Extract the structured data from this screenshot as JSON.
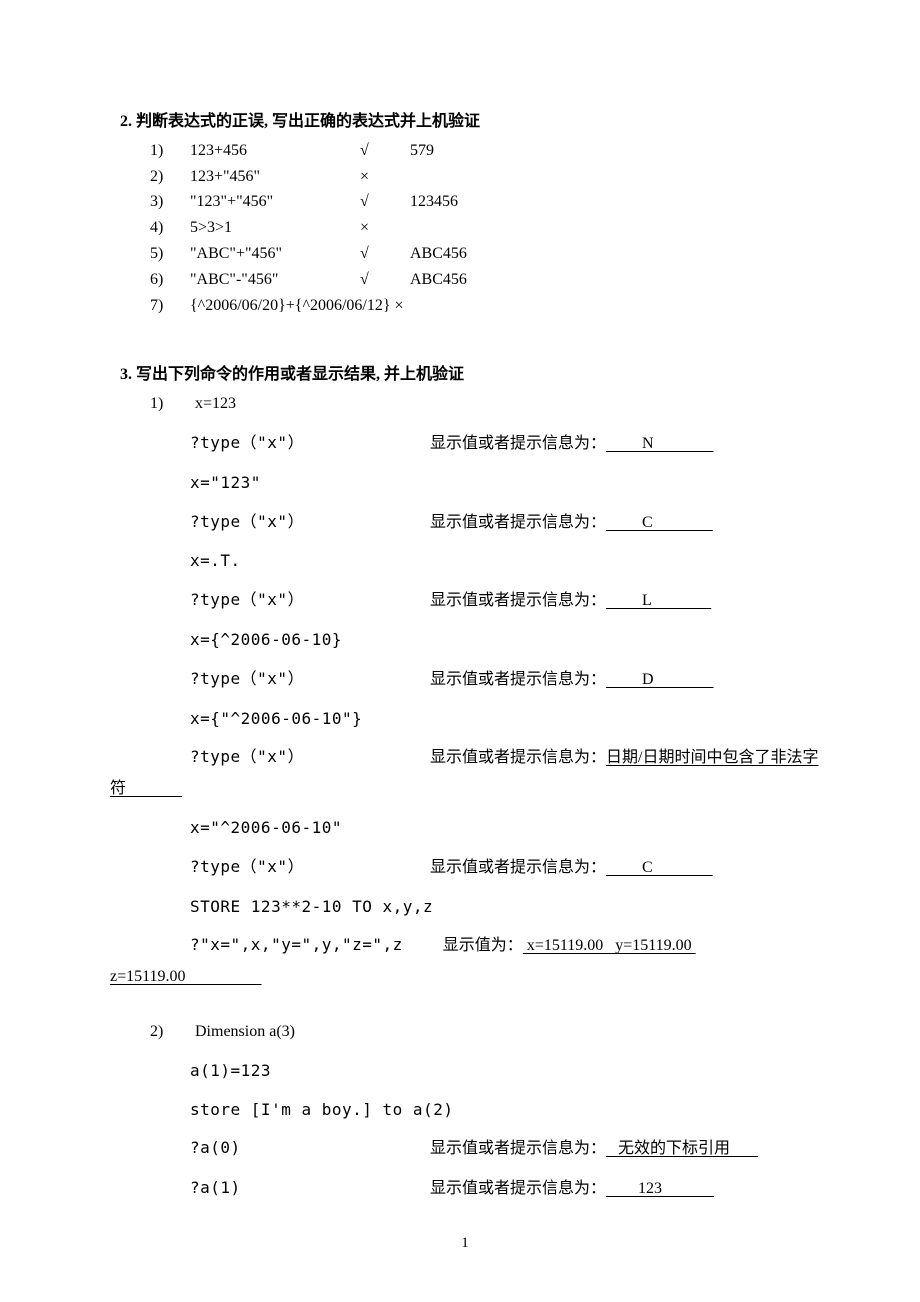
{
  "section2": {
    "heading": "2.  判断表达式的正误, 写出正确的表达式并上机验证",
    "items": [
      {
        "num": "1)",
        "expr": "123+456",
        "mark": "√",
        "result": "579"
      },
      {
        "num": "2)",
        "expr": "123+\"456\"",
        "mark": "×",
        "result": ""
      },
      {
        "num": "3)",
        "expr": "\"123\"+\"456\"",
        "mark": "√",
        "result": "123456"
      },
      {
        "num": "4)",
        "expr": "5>3>1",
        "mark": "×",
        "result": ""
      },
      {
        "num": "5)",
        "expr": "\"ABC\"+\"456\"",
        "mark": "√",
        "result": "ABC456"
      },
      {
        "num": "6)",
        "expr": "\"ABC\"-\"456\"",
        "mark": "√",
        "result": "ABC456"
      },
      {
        "num": "7)",
        "expr": "{^2006/06/20}+{^2006/06/12}    ×",
        "mark": "",
        "result": ""
      }
    ]
  },
  "section3": {
    "heading": "3.  写出下列命令的作用或者显示结果, 并上机验证",
    "sub1_num": "1)",
    "sub1_first": "x=123",
    "lines": [
      {
        "code": "?type（\"x\"）",
        "prompt": "显示值或者提示信息为：",
        "answer": "         N               "
      },
      {
        "code": "x=\"123\"",
        "prompt": "",
        "answer": ""
      },
      {
        "code": "?type（\"x\"）",
        "prompt": "显示值或者提示信息为：",
        "answer": "         C               "
      },
      {
        "code": "x=.T.",
        "prompt": "",
        "answer": ""
      },
      {
        "code": "?type（\"x\"）",
        "prompt": "显示值或者提示信息为：",
        "answer": "         L               "
      },
      {
        "code": "x={^2006-06-10}",
        "prompt": "",
        "answer": ""
      },
      {
        "code": "?type（\"x\"）",
        "prompt": "显示值或者提示信息为：",
        "answer": "         D               "
      },
      {
        "code": "x={\"^2006-06-10\"}",
        "prompt": "",
        "answer": ""
      }
    ],
    "illegal_code": "?type（\"x\"）",
    "illegal_prompt": "显示值或者提示信息为：",
    "illegal_answer_1": "日期/日期时间中包含了非法字",
    "illegal_answer_2": "符              ",
    "lines_after": [
      {
        "code": "x=\"^2006-06-10\"",
        "prompt": "",
        "answer": ""
      },
      {
        "code": "?type（\"x\"）",
        "prompt": "显示值或者提示信息为：",
        "answer": "         C               "
      },
      {
        "code": "STORE 123**2-10 TO x,y,z",
        "prompt": "",
        "answer": ""
      }
    ],
    "store_code": "?\"x=\",x,\"y=\",y,\"z=\",z",
    "store_prompt": "显示值为：",
    "store_answer_1": " x=15119.00   y=15119.00 ",
    "store_answer_2": "z=15119.00                   ",
    "sub2_num": "2)",
    "sub2_first": "Dimension a(3)",
    "sub2_lines": [
      {
        "code": "a(1)=123",
        "prompt": "",
        "answer": ""
      },
      {
        "code": "store [I'm a boy.] to a(2)",
        "prompt": "",
        "answer": ""
      },
      {
        "code": "?a(0)",
        "prompt": "显示值或者提示信息为：",
        "answer": "   无效的下标引用       "
      },
      {
        "code": "?a(1)",
        "prompt": "显示值或者提示信息为：",
        "answer": "        123             "
      }
    ]
  },
  "page_number": "1"
}
